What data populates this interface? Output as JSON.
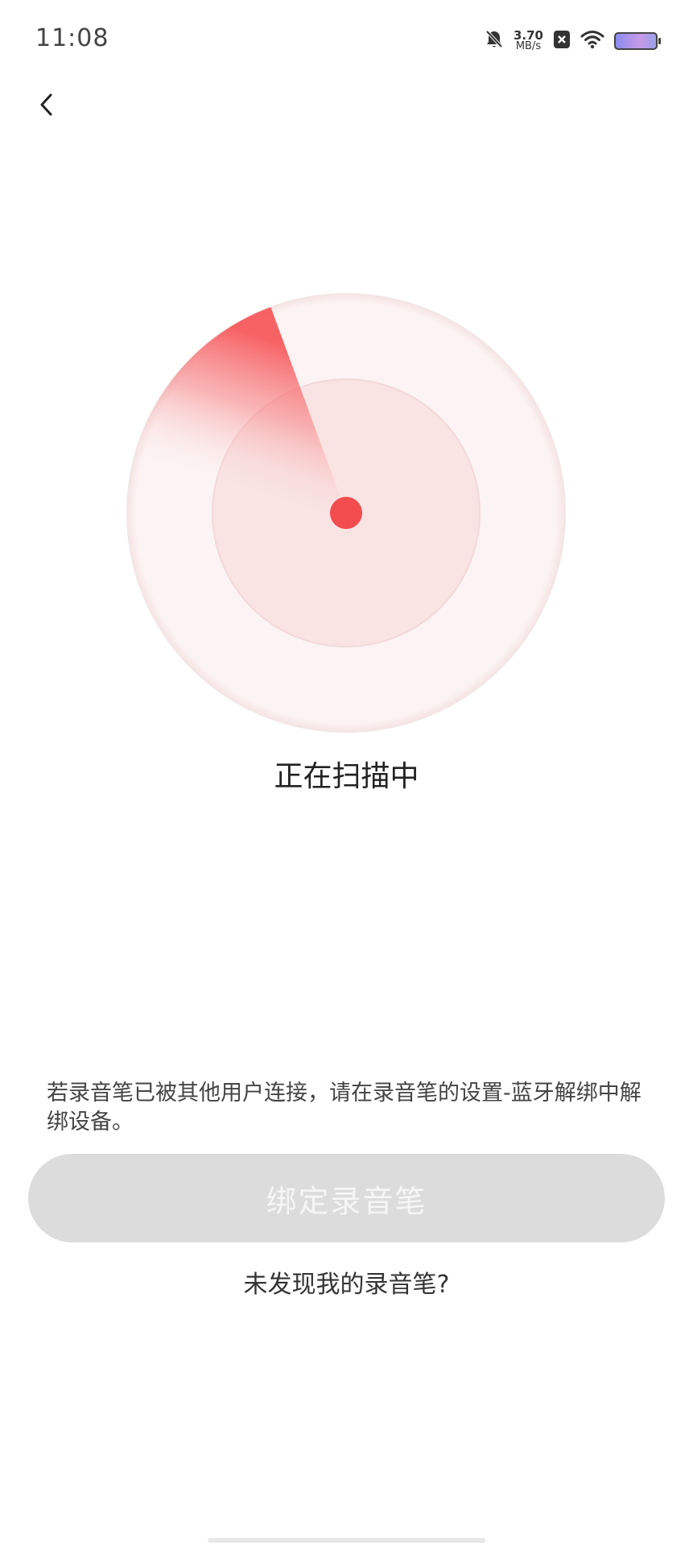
{
  "status_bar": {
    "time": "11:08",
    "net_speed_value": "3.70",
    "net_speed_unit": "MB/s"
  },
  "icons": {
    "back": "chevron-left-icon",
    "mute": "bell-off-icon",
    "close_box": "close-box-icon",
    "wifi": "wifi-icon",
    "battery": "battery-icon"
  },
  "main": {
    "scan_status": "正在扫描中",
    "hint": "若录音笔已被其他用户连接，请在录音笔的设置-蓝牙解绑中解绑设备。",
    "bind_button": "绑定录音笔",
    "not_found_link": "未发现我的录音笔?"
  },
  "colors": {
    "accent": "#f24c4f",
    "button_disabled": "#dcdcdc",
    "radar_outer": "#fdf5f5",
    "radar_inner": "#f9e2e2"
  }
}
